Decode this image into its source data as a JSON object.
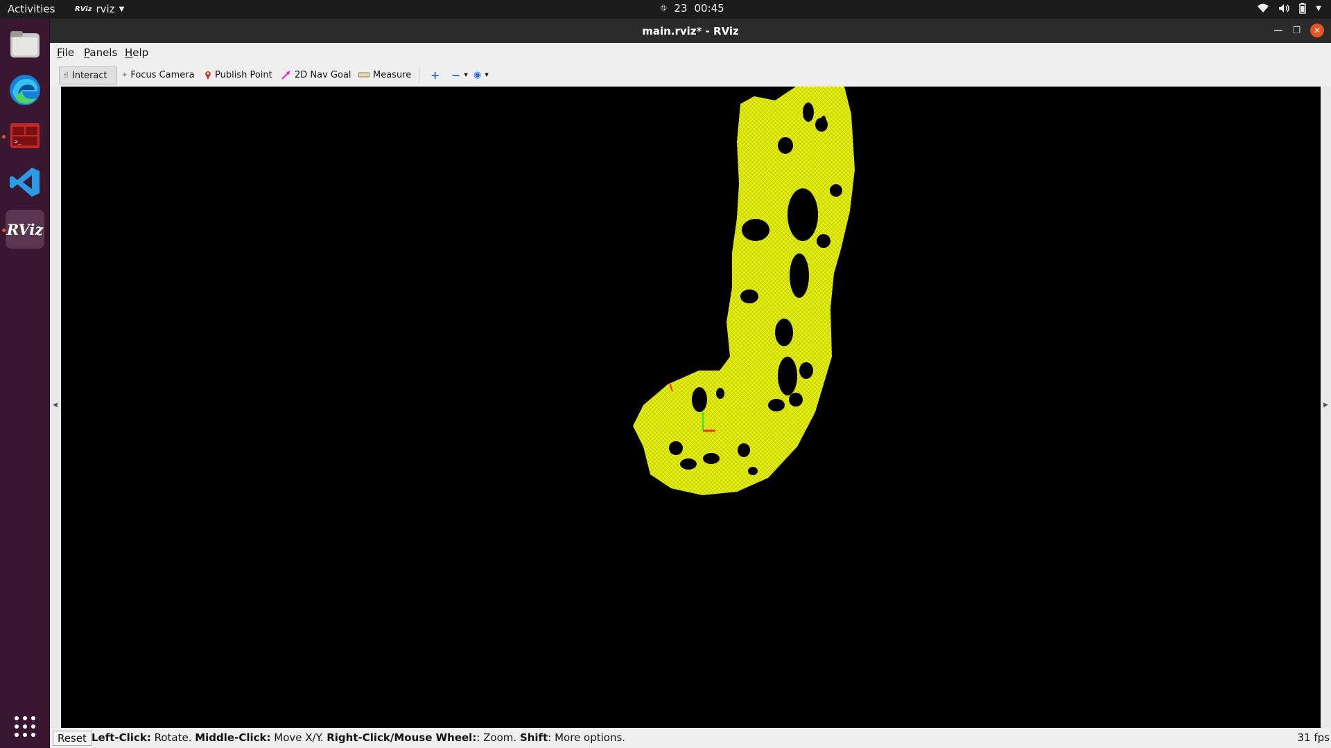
{
  "topbar": {
    "activities": "Activities",
    "app_name": "rviz",
    "app_icon_text": "RViz",
    "date": "23",
    "time": "00:45"
  },
  "dock": {
    "items": [
      {
        "name": "files"
      },
      {
        "name": "edge"
      },
      {
        "name": "terminal"
      },
      {
        "name": "vscode"
      },
      {
        "name": "rviz",
        "label": "RViz"
      }
    ]
  },
  "window": {
    "title": "main.rviz* - RViz"
  },
  "menu": {
    "file": "F",
    "file_rest": "ile",
    "panels": "P",
    "panels_rest": "anels",
    "help": "H",
    "help_rest": "elp"
  },
  "toolbar": {
    "interact": "Interact",
    "focus_camera": "Focus Camera",
    "publish_point": "Publish Point",
    "nav_goal": "2D Nav Goal",
    "measure": "Measure"
  },
  "status": {
    "reset": "Reset",
    "left_click": "Left-Click:",
    "left_click_action": " Rotate. ",
    "middle_click": "Middle-Click:",
    "middle_click_action": " Move X/Y. ",
    "right_click": "Right-Click/Mouse Wheel:",
    "right_click_action": ": Zoom. ",
    "shift": "Shift",
    "shift_action": ": More options.",
    "fps": "31 fps"
  },
  "colors": {
    "pointcloud": "#e8f20a",
    "accent": "#e95420"
  }
}
